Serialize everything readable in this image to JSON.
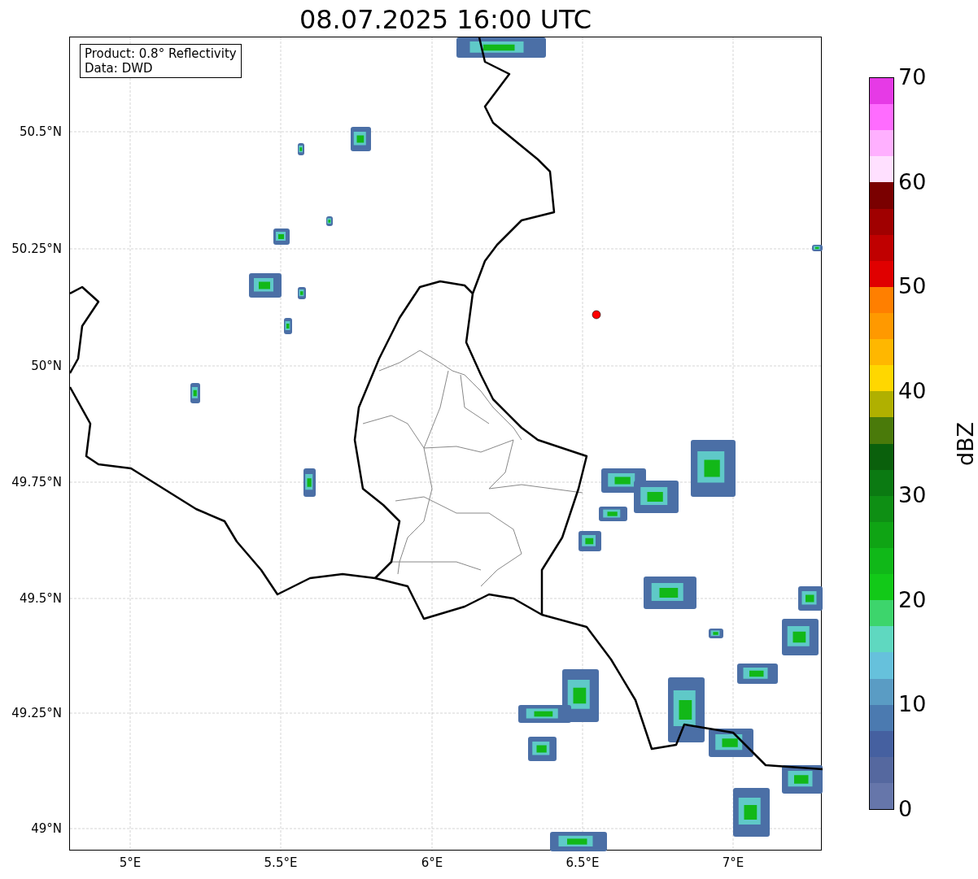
{
  "title": "08.07.2025 16:00 UTC",
  "legend": [
    "Product: 0.8° Reflectivity",
    "Data: DWD"
  ],
  "y_ticks": [
    "50.5°N",
    "50.25°N",
    "50°N",
    "49.75°N",
    "49.5°N",
    "49.25°N",
    "49°N"
  ],
  "x_ticks": [
    "5°E",
    "5.5°E",
    "6°E",
    "6.5°E",
    "7°E"
  ],
  "colorbar": {
    "label": "dBZ",
    "ticks": [
      "70",
      "60",
      "50",
      "40",
      "30",
      "20",
      "10",
      "0"
    ],
    "segments": [
      {
        "color": "#e63ae6"
      },
      {
        "color": "#ff6cff"
      },
      {
        "color": "#ffb0ff"
      },
      {
        "color": "#ffe0ff"
      },
      {
        "color": "#7a0000"
      },
      {
        "color": "#a00000"
      },
      {
        "color": "#c00000"
      },
      {
        "color": "#e00000"
      },
      {
        "color": "#ff7f00"
      },
      {
        "color": "#ff9900"
      },
      {
        "color": "#ffb700"
      },
      {
        "color": "#ffd700"
      },
      {
        "color": "#b0b000"
      },
      {
        "color": "#4a7a0a"
      },
      {
        "color": "#0a600c"
      },
      {
        "color": "#0b7a12"
      },
      {
        "color": "#0e8f14"
      },
      {
        "color": "#0fa414"
      },
      {
        "color": "#10b818"
      },
      {
        "color": "#12c918"
      },
      {
        "color": "#3dd56c"
      },
      {
        "color": "#5fd8c0"
      },
      {
        "color": "#66c1dc"
      },
      {
        "color": "#5a9cc4"
      },
      {
        "color": "#4b7ab0"
      },
      {
        "color": "#4560a0"
      },
      {
        "color": "#55689f"
      },
      {
        "color": "#6676aa"
      }
    ]
  }
}
